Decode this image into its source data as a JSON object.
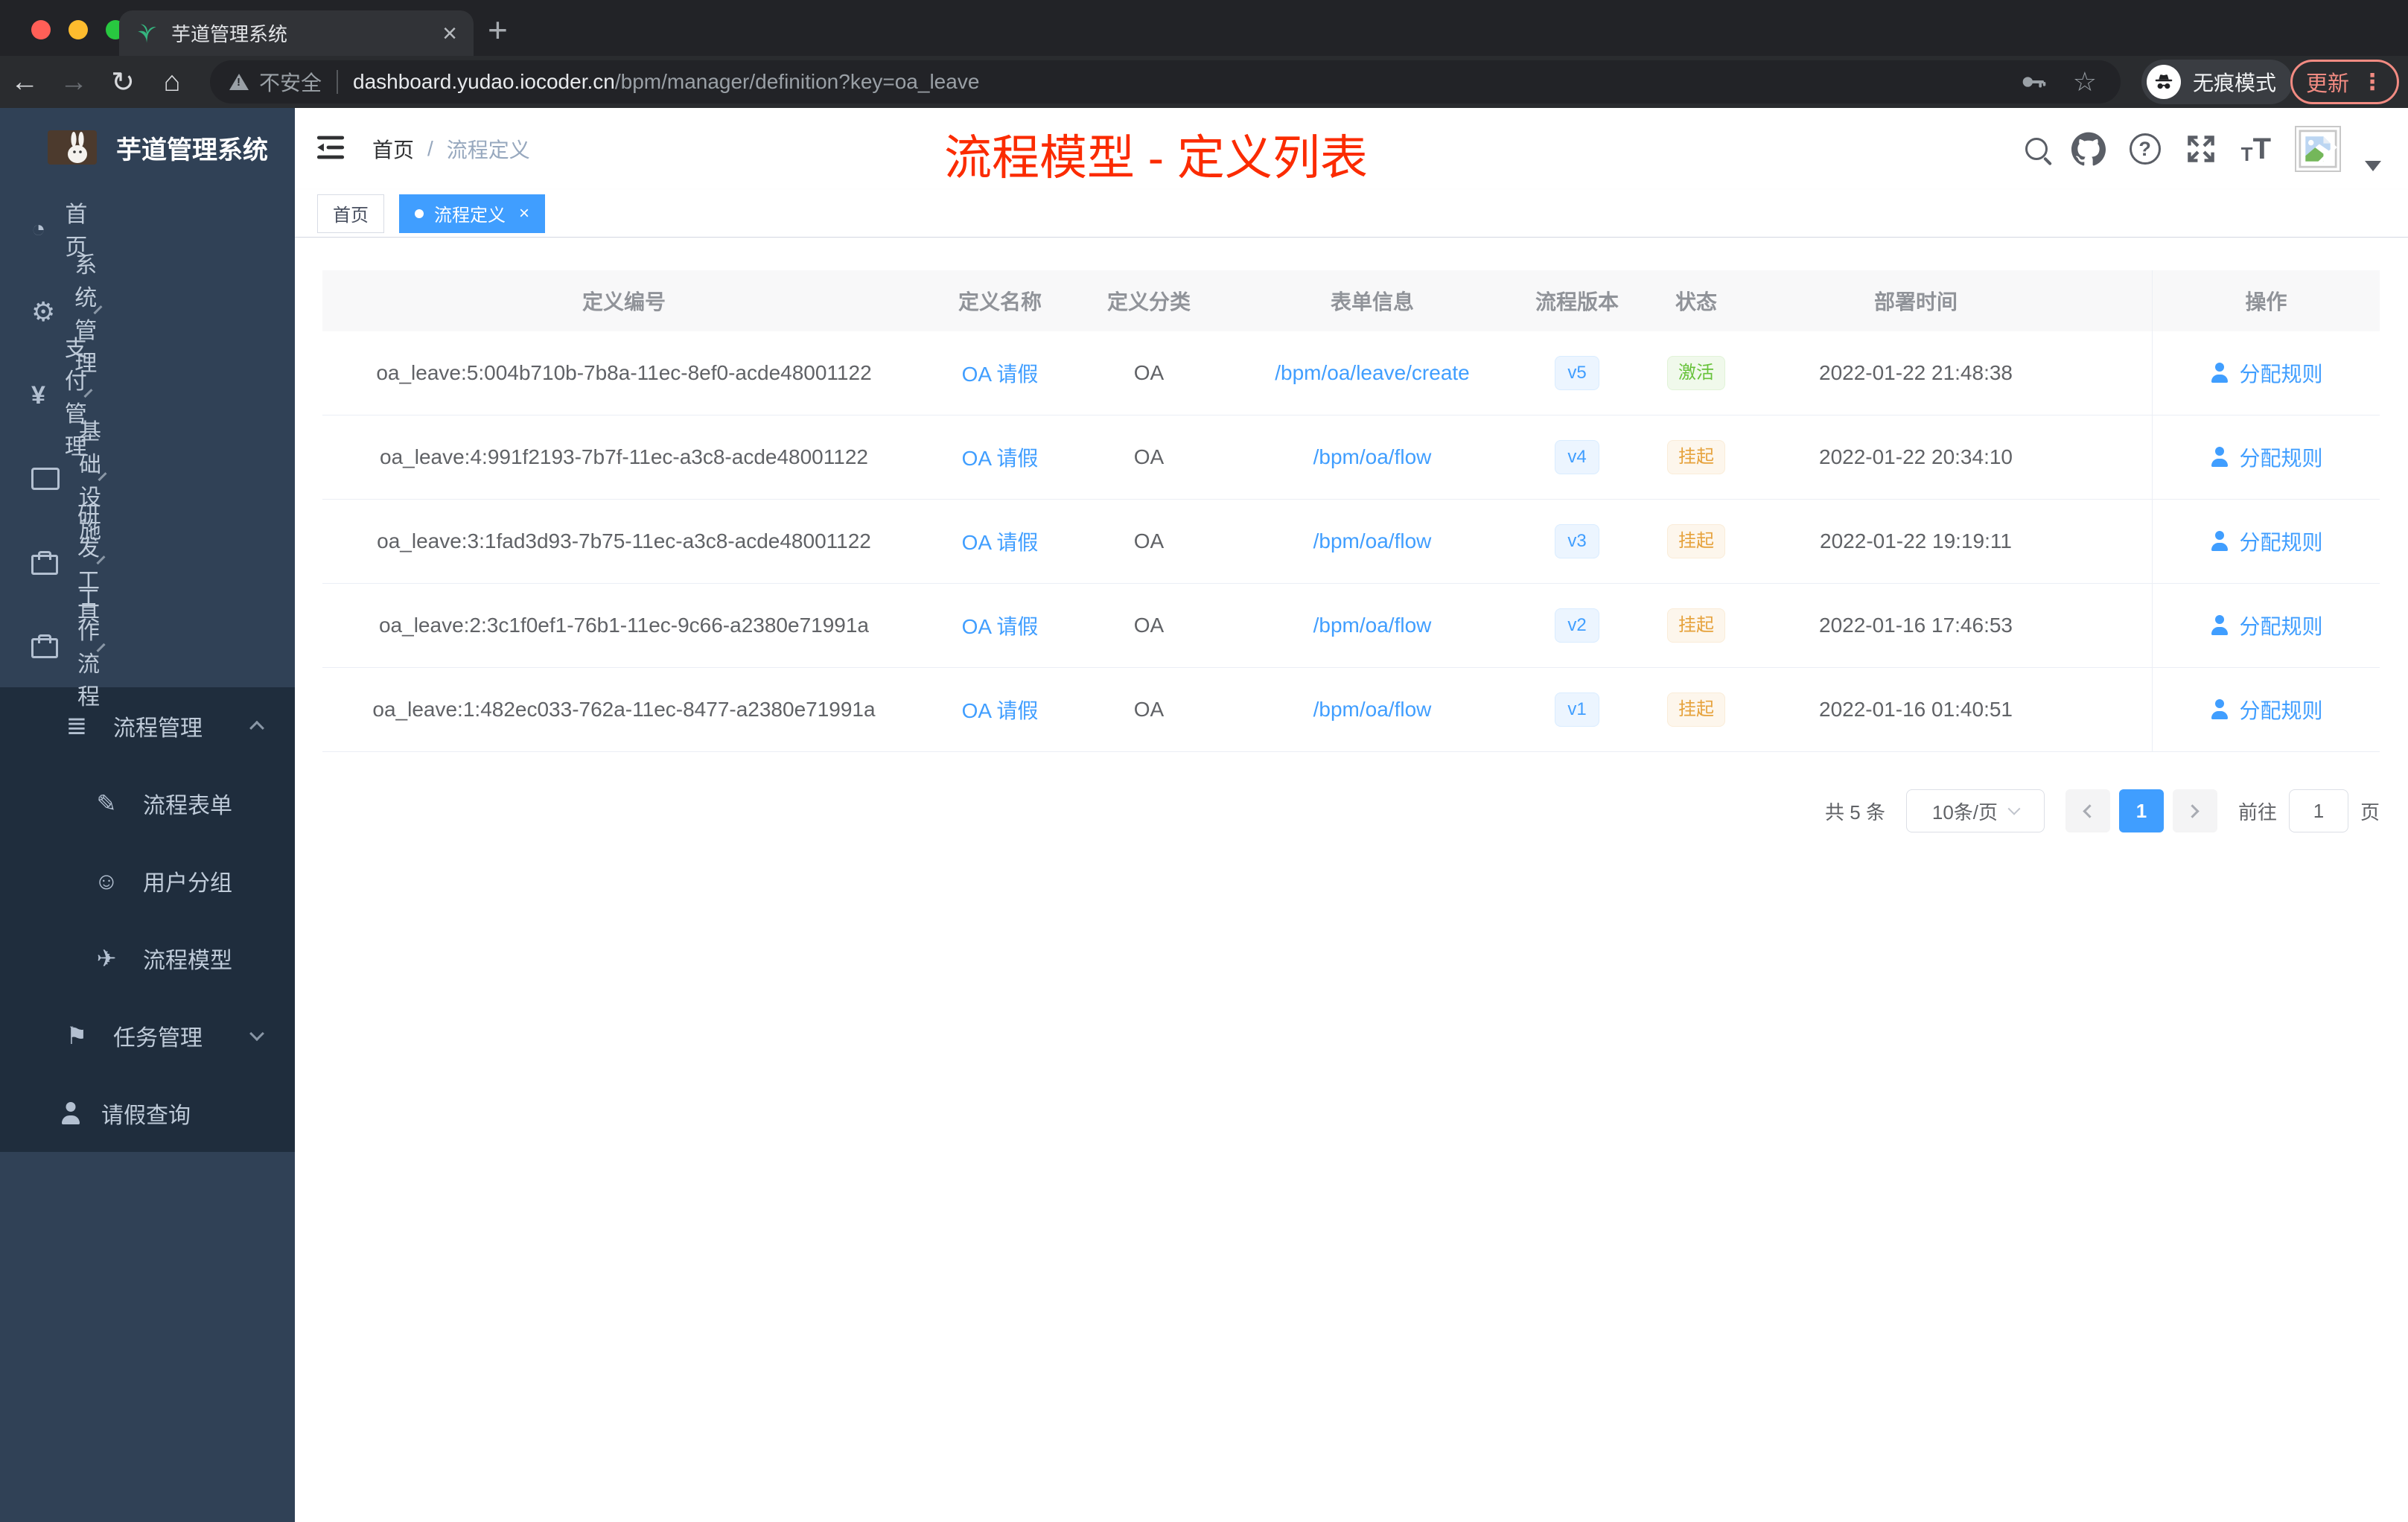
{
  "browser": {
    "tab_title": "芋道管理系统",
    "address": {
      "security_label": "不安全",
      "host": "dashboard.yudao.iocoder.cn",
      "path": "/bpm/manager/definition?key=oa_leave"
    },
    "incognito_label": "无痕模式",
    "update_label": "更新"
  },
  "sidebar": {
    "title": "芋道管理系统",
    "menu": [
      {
        "label": "首页",
        "icon": "ic-dashboard",
        "arrow": "",
        "indent": "lv0",
        "section": "light"
      },
      {
        "label": "系统管理",
        "icon": "ic-gear",
        "arrow": "down",
        "indent": "lv0",
        "section": "light"
      },
      {
        "label": "支付管理",
        "icon": "ic-yen",
        "arrow": "down",
        "indent": "lv0",
        "section": "light"
      },
      {
        "label": "基础设施",
        "icon": "ic-monitor",
        "arrow": "down",
        "indent": "lv0",
        "section": "light"
      },
      {
        "label": "研发工具",
        "icon": "ic-tool",
        "arrow": "down",
        "indent": "lv0",
        "section": "light"
      },
      {
        "label": "工作流程",
        "icon": "ic-briefcase",
        "arrow": "up",
        "indent": "lv0",
        "section": "light"
      },
      {
        "label": "流程管理",
        "icon": "ic-list",
        "arrow": "up",
        "indent": "lv1",
        "section": "dark"
      },
      {
        "label": "流程表单",
        "icon": "ic-form",
        "arrow": "",
        "indent": "lv2",
        "section": "dark"
      },
      {
        "label": "用户分组",
        "icon": "ic-group",
        "arrow": "",
        "indent": "lv2",
        "section": "dark"
      },
      {
        "label": "流程模型",
        "icon": "ic-send",
        "arrow": "",
        "indent": "lv2",
        "section": "dark"
      },
      {
        "label": "任务管理",
        "icon": "ic-tasks",
        "arrow": "down",
        "indent": "lv1",
        "section": "dark"
      },
      {
        "label": "请假查询",
        "icon": "ic-person",
        "arrow": "",
        "indent": "lv1",
        "section": "dark"
      }
    ]
  },
  "header": {
    "breadcrumb_home": "首页",
    "breadcrumb_sep": "/",
    "breadcrumb_current": "流程定义",
    "annotation": "流程模型 - 定义列表"
  },
  "tags": {
    "items": [
      {
        "label": "首页",
        "type": "plain"
      },
      {
        "label": "流程定义",
        "type": "active"
      }
    ]
  },
  "table": {
    "columns": [
      "定义编号",
      "定义名称",
      "定义分类",
      "表单信息",
      "流程版本",
      "状态",
      "部署时间",
      "操作"
    ],
    "action_label": "分配规则",
    "rows": [
      {
        "id": "oa_leave:5:004b710b-7b8a-11ec-8ef0-acde48001122",
        "name": "OA 请假",
        "category": "OA",
        "form": "/bpm/oa/leave/create",
        "version": "v5",
        "status": "激活",
        "status_type": "success",
        "time": "2022-01-22 21:48:38"
      },
      {
        "id": "oa_leave:4:991f2193-7b7f-11ec-a3c8-acde48001122",
        "name": "OA 请假",
        "category": "OA",
        "form": "/bpm/oa/flow",
        "version": "v4",
        "status": "挂起",
        "status_type": "warning",
        "time": "2022-01-22 20:34:10"
      },
      {
        "id": "oa_leave:3:1fad3d93-7b75-11ec-a3c8-acde48001122",
        "name": "OA 请假",
        "category": "OA",
        "form": "/bpm/oa/flow",
        "version": "v3",
        "status": "挂起",
        "status_type": "warning",
        "time": "2022-01-22 19:19:11"
      },
      {
        "id": "oa_leave:2:3c1f0ef1-76b1-11ec-9c66-a2380e71991a",
        "name": "OA 请假",
        "category": "OA",
        "form": "/bpm/oa/flow",
        "version": "v2",
        "status": "挂起",
        "status_type": "warning",
        "time": "2022-01-16 17:46:53"
      },
      {
        "id": "oa_leave:1:482ec033-762a-11ec-8477-a2380e71991a",
        "name": "OA 请假",
        "category": "OA",
        "form": "/bpm/oa/flow",
        "version": "v1",
        "status": "挂起",
        "status_type": "warning",
        "time": "2022-01-16 01:40:51"
      }
    ]
  },
  "pagination": {
    "total": "共 5 条",
    "page_size": "10条/页",
    "page": "1",
    "jump_prefix": "前往",
    "jump_value": "1",
    "jump_suffix": "页"
  }
}
